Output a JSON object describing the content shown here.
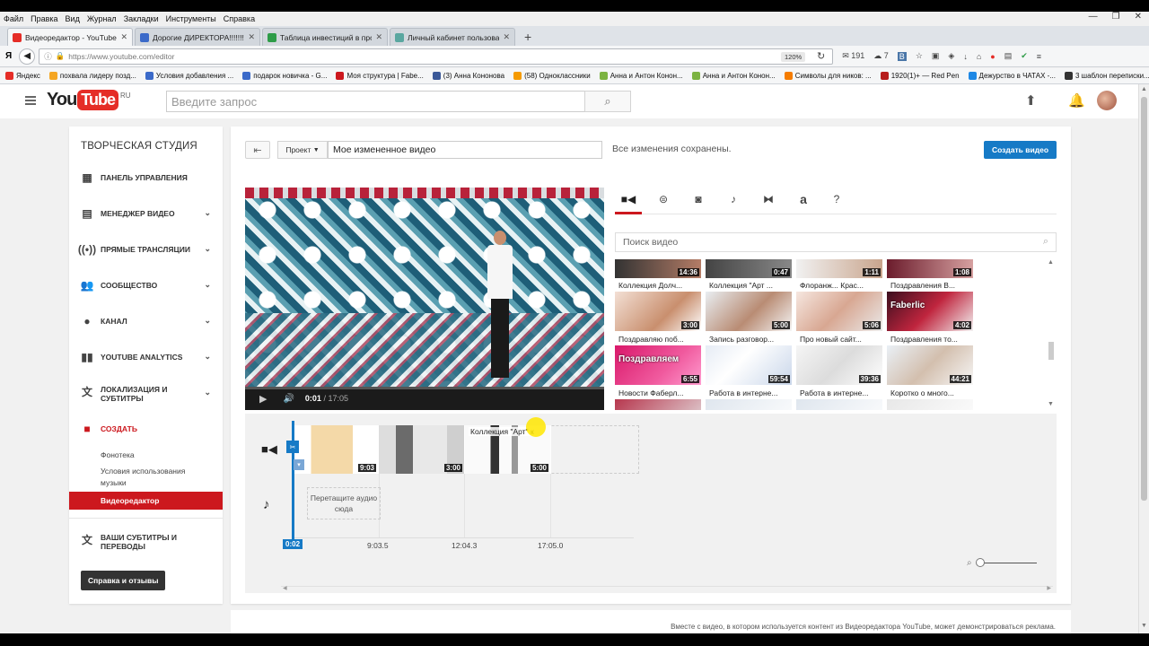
{
  "menubar": [
    "Файл",
    "Правка",
    "Вид",
    "Журнал",
    "Закладки",
    "Инструменты",
    "Справка"
  ],
  "tabs": [
    {
      "label": "Видеоредактор - YouTube",
      "icon_color": "#e52d27",
      "active": true
    },
    {
      "label": "Дорогие ДИРЕКТОРА!!!!!!!!",
      "icon_color": "#3b6ac9",
      "active": false
    },
    {
      "label": "Таблица инвестиций в про",
      "icon_color": "#2e9c48",
      "active": false
    },
    {
      "label": "Личный кабинет пользова",
      "icon_color": "#5aa7a0",
      "active": false
    }
  ],
  "url": "https://www.youtube.com/editor",
  "zoom": "120%",
  "nav_counts": {
    "mail": "191",
    "cloud": "7"
  },
  "bookmarks": [
    {
      "label": "Яндекс",
      "color": "#e52d27"
    },
    {
      "label": "похвала лидеру позд...",
      "color": "#f5a623"
    },
    {
      "label": "Условия добавления ...",
      "color": "#3b6ac9"
    },
    {
      "label": "подарок новичка - G...",
      "color": "#3b6ac9"
    },
    {
      "label": "Моя структура | Fabe...",
      "color": "#cc181e"
    },
    {
      "label": "(3) Анна Кононова",
      "color": "#3b5998"
    },
    {
      "label": "(58) Одноклассники",
      "color": "#f59a00"
    },
    {
      "label": "Анна и Антон Конон...",
      "color": "#7cb342"
    },
    {
      "label": "Анна и Антон Конон...",
      "color": "#7cb342"
    },
    {
      "label": "Символы для ников: ...",
      "color": "#f57c00"
    },
    {
      "label": "1920(1)+ — Red Pen",
      "color": "#b71c1c"
    },
    {
      "label": "Дежурство в ЧАТАХ -...",
      "color": "#1e88e5"
    },
    {
      "label": "3 шаблон переписки...",
      "color": "#333333"
    }
  ],
  "yt": {
    "logo_you": "You",
    "logo_tube": "Tube",
    "logo_region": "RU",
    "search_placeholder": "Введите запрос"
  },
  "sidebar": {
    "title": "ТВОРЧЕСКАЯ СТУДИЯ",
    "items": [
      {
        "label": "ПАНЕЛЬ УПРАВЛЕНИЯ",
        "icon": "dashboard-icon"
      },
      {
        "label": "МЕНЕДЖЕР ВИДЕО",
        "icon": "video-manager-icon"
      },
      {
        "label": "ПРЯМЫЕ ТРАНСЛЯЦИИ",
        "icon": "live-icon"
      },
      {
        "label": "СООБЩЕСТВО",
        "icon": "community-icon"
      },
      {
        "label": "КАНАЛ",
        "icon": "channel-icon"
      },
      {
        "label": "YOUTUBE ANALYTICS",
        "icon": "analytics-icon"
      },
      {
        "label": "ЛОКАЛИЗАЦИЯ И СУБТИТРЫ",
        "icon": "translate-icon"
      },
      {
        "label": "СОЗДАТЬ",
        "icon": "create-icon"
      }
    ],
    "create_sub": [
      "Фонотека",
      "Условия использования музыки"
    ],
    "active_sub": "Видеоредактор",
    "subtitles": "ВАШИ СУБТИТРЫ И ПЕРЕВОДЫ",
    "help": "Справка и отзывы"
  },
  "editor": {
    "project_label": "Проект",
    "project_name": "Мое измененное видео",
    "saved": "Все изменения сохранены.",
    "create_button": "Создать видео",
    "player": {
      "current": "0:01",
      "total": "/ 17:05"
    },
    "video_search_placeholder": "Поиск видео",
    "grid_top_durations": [
      "14:36",
      "0:47",
      "1:11",
      "1:08"
    ],
    "grid": [
      {
        "title": "Коллекция Долч...",
        "duration": "3:00",
        "overlay": ""
      },
      {
        "title": "Коллекция \"Арт ...",
        "duration": "5:00",
        "overlay": ""
      },
      {
        "title": "Флоранж... Крас...",
        "duration": "5:06",
        "overlay": ""
      },
      {
        "title": "Поздравления В...",
        "duration": "4:02",
        "overlay": "Faberlic"
      },
      {
        "title": "Поздравляю поб...",
        "duration": "6:55",
        "overlay": "Поздравляем"
      },
      {
        "title": "Запись разговор...",
        "duration": "59:54",
        "overlay": ""
      },
      {
        "title": "Про новый сайт...",
        "duration": "39:36",
        "overlay": ""
      },
      {
        "title": "Поздравления то...",
        "duration": "44:21",
        "overlay": ""
      },
      {
        "title": "Новости Фаберл...",
        "duration": "",
        "overlay": ""
      },
      {
        "title": "Работа в интерне...",
        "duration": "",
        "overlay": ""
      },
      {
        "title": "Работа в интерне...",
        "duration": "",
        "overlay": ""
      },
      {
        "title": "Коротко о много...",
        "duration": "",
        "overlay": ""
      }
    ],
    "timeline": {
      "clips": [
        {
          "duration": "9:03",
          "name": ""
        },
        {
          "duration": "3:00",
          "name": ""
        },
        {
          "duration": "5:00",
          "name": "Коллекция \"Арт\" к"
        }
      ],
      "audio_drop": "Перетащите аудио сюда",
      "playhead": "0:02",
      "ticks": [
        "9:03.5",
        "12:04.3",
        "17:05.0"
      ]
    },
    "footnote": "Вместе с видео, в котором используется контент из Видеоредактора YouTube, может демонстрироваться реклама."
  }
}
